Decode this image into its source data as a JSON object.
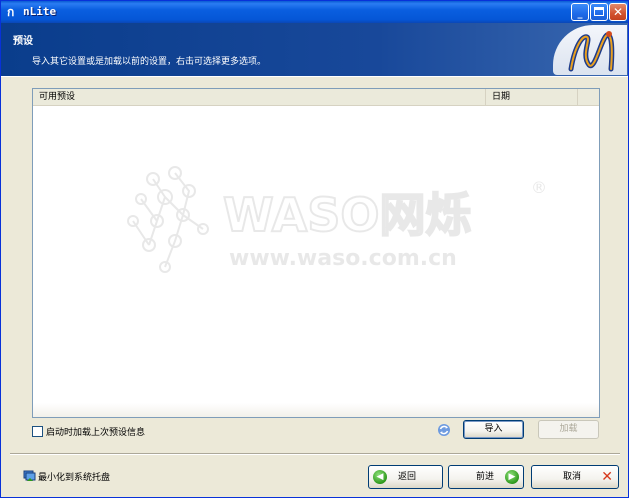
{
  "window": {
    "title": "nLite",
    "app_icon": "nlite-logo-icon",
    "controls": [
      "minimize-icon",
      "maximize-icon",
      "close-icon"
    ]
  },
  "header": {
    "title": "预设",
    "subtitle": "导入其它设置或是加载以前的设置，右击可选择更多选项。"
  },
  "table": {
    "columns": [
      "可用预设",
      "日期"
    ],
    "rows": []
  },
  "watermark": {
    "brand": "WASO网烁",
    "url": "www.waso.com.cn",
    "mark": "®"
  },
  "options": {
    "load_last_preset_label": "启动时加载上次预设信息",
    "load_last_preset_checked": false
  },
  "buttons": {
    "import": "导入",
    "load": "加载",
    "back": "返回",
    "next": "前进",
    "cancel": "取消",
    "minimize_to_tray": "最小化到系统托盘"
  },
  "colors": {
    "header_bg": "#0a3d8c",
    "titlebar": "#0556d6",
    "accent_green": "#2e9a1c",
    "cancel_red": "#d6381c"
  }
}
